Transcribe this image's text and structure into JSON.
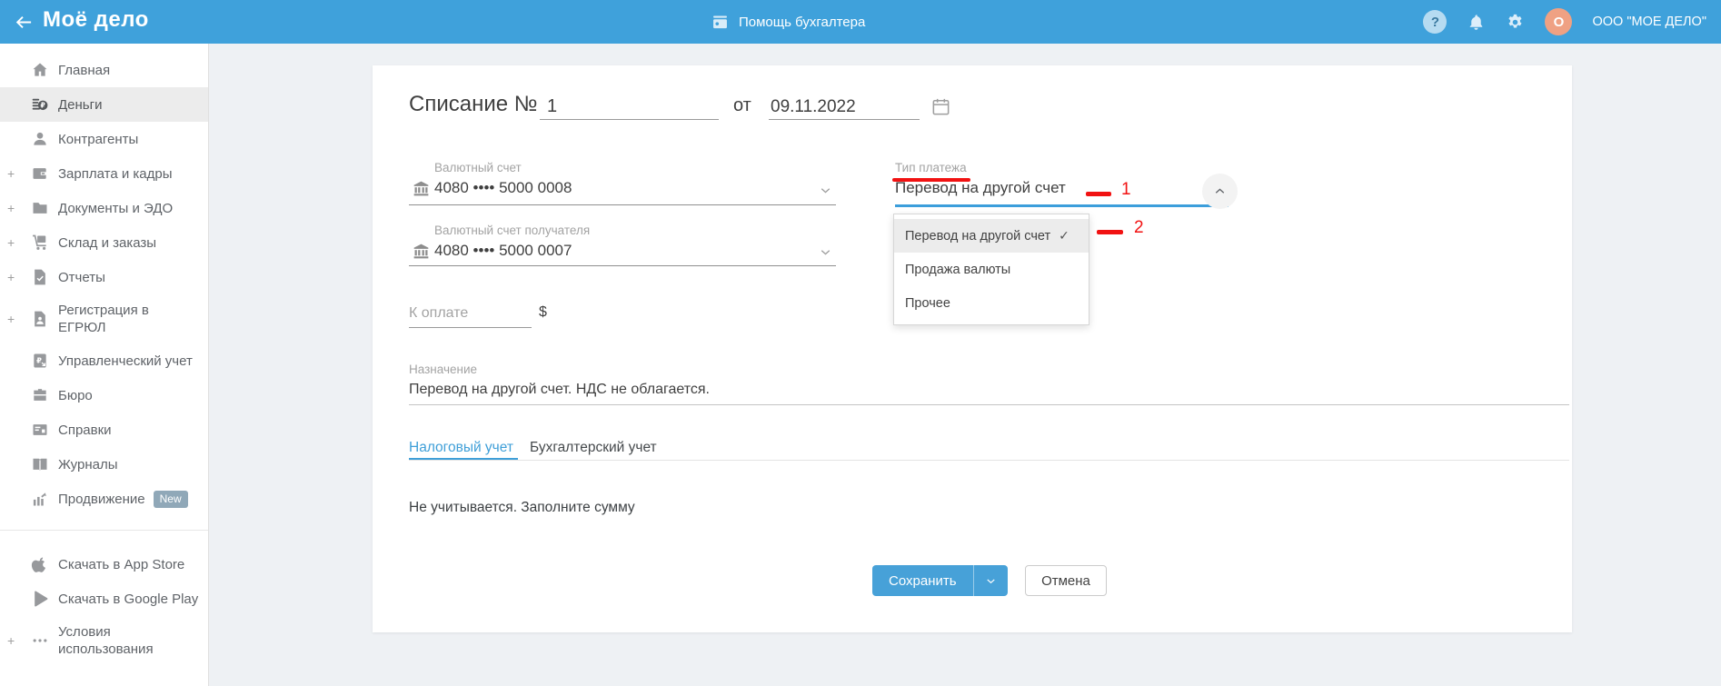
{
  "colors": {
    "header_blue": "#3fa1db",
    "accent_blue": "#3f9fd8",
    "annotation_red": "#f11212",
    "avatar_orange": "#efa183",
    "badge_blue_gray": "#90a8b8",
    "selected_option_bg": "#ececec"
  },
  "header": {
    "logo": "Моё дело",
    "help_center": "Помощь бухгалтера",
    "help_glyph": "?",
    "avatar_initial": "О",
    "company": "ООО \"МОЕ ДЕЛО\""
  },
  "sidebar": {
    "items": [
      {
        "id": "home",
        "icon": "home",
        "label": "Главная"
      },
      {
        "id": "money",
        "icon": "money",
        "label": "Деньги",
        "active": true
      },
      {
        "id": "contractors",
        "icon": "person",
        "label": "Контрагенты"
      },
      {
        "id": "salary",
        "icon": "wallet",
        "label": "Зарплата и кадры",
        "expandable": true
      },
      {
        "id": "documents",
        "icon": "folder",
        "label": "Документы и ЭДО",
        "expandable": true
      },
      {
        "id": "warehouse",
        "icon": "cart",
        "label": "Склад и заказы",
        "expandable": true
      },
      {
        "id": "reports",
        "icon": "report",
        "label": "Отчеты",
        "expandable": true
      },
      {
        "id": "egrul",
        "icon": "doc-person",
        "label": "Регистрация в ЕГРЮЛ",
        "expandable": true,
        "twoline": true
      },
      {
        "id": "management",
        "icon": "ruble-doc",
        "label": "Управленческий учет"
      },
      {
        "id": "bureau",
        "icon": "briefcase",
        "label": "Бюро"
      },
      {
        "id": "certificates",
        "icon": "id-card",
        "label": "Справки"
      },
      {
        "id": "journals",
        "icon": "book",
        "label": "Журналы"
      },
      {
        "id": "promotion",
        "icon": "chart",
        "label": "Продвижение",
        "badge": "New"
      }
    ],
    "footer_items": [
      {
        "id": "app-store",
        "icon": "apple",
        "label": "Скачать в App Store"
      },
      {
        "id": "google-play",
        "icon": "google-play",
        "label": "Скачать в Google Play"
      },
      {
        "id": "terms",
        "icon": "ellipsis",
        "label": "Условия использования",
        "expandable": true,
        "twoline": true
      }
    ]
  },
  "form": {
    "title": "Списание №",
    "number": "1",
    "date_label": "от",
    "date": "09.11.2022",
    "account_from": {
      "label": "Валютный счет",
      "value": "4080 •••• 5000 0008"
    },
    "account_to": {
      "label": "Валютный счет получателя",
      "value": "4080 •••• 5000 0007"
    },
    "payment_type": {
      "label": "Тип платежа",
      "value": "Перевод на другой счет"
    },
    "amount": {
      "placeholder": "К оплате",
      "currency": "$"
    },
    "purpose": {
      "label": "Назначение",
      "value": "Перевод на другой счет. НДС не облагается."
    },
    "dropdown_options": [
      {
        "label": "Перевод на другой счет",
        "selected": true,
        "check": "✓"
      },
      {
        "label": "Продажа валюты"
      },
      {
        "label": "Прочее"
      }
    ],
    "tabs": [
      {
        "label": "Налоговый учет",
        "active": true
      },
      {
        "label": "Бухгалтерский учет",
        "active": false
      }
    ],
    "tab_content": "Не учитывается. Заполните сумму",
    "save": "Сохранить",
    "cancel": "Отмена"
  },
  "annotations": {
    "mark1": "1",
    "mark2": "2"
  }
}
